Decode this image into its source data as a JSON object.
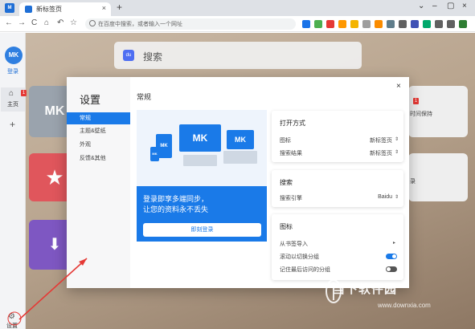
{
  "browser": {
    "app_badge": "M",
    "tab_title": "新标签页",
    "tab_close": "×",
    "new_tab": "+",
    "window_controls": [
      "⌄",
      "–",
      "▢",
      "×"
    ]
  },
  "toolbar": {
    "nav": [
      "←",
      "→",
      "C",
      "⌂",
      "↶",
      "☆"
    ],
    "omnibox_placeholder": "在百度中搜索，或者输入一个网址",
    "extension_colors": [
      "#1a73e8",
      "#4caf50",
      "#e53935",
      "#ff9800",
      "#f4b400",
      "#9e9e9e",
      "#fb8c00",
      "#607d8b",
      "#616161",
      "#3f51b5",
      "#00a86b",
      "#616161",
      "#616161",
      "#2e7d32"
    ]
  },
  "sidebar": {
    "logo": "MK",
    "login": "登录",
    "home_label": "主页",
    "home_badge": "1",
    "add": "+",
    "settings_label": "设置"
  },
  "background": {
    "search_icon": "du",
    "search_text": "搜索",
    "tile_mk": "MK",
    "tile_star": "★",
    "tile_folder": "⬇",
    "right_badge": "1",
    "right_text_1": "时间保持",
    "right_text_2": "录"
  },
  "settings": {
    "heading": "设置",
    "close": "×",
    "nav_items": [
      "常规",
      "主题&壁纸",
      "外观",
      "反馈&其他"
    ],
    "section_title": "常规",
    "promo": {
      "line1": "登录即享多端同步，",
      "line2": "让您的资料永不丢失",
      "button": "即刻登录",
      "logo_text": "MK"
    },
    "open_mode": {
      "title": "打开方式",
      "rows": [
        {
          "label": "图标",
          "value": "新标签页"
        },
        {
          "label": "搜索结果",
          "value": "新标签页"
        }
      ]
    },
    "search": {
      "title": "搜索",
      "rows": [
        {
          "label": "搜索引擎",
          "value": "Baidu"
        }
      ]
    },
    "icons": {
      "title": "图标",
      "import_label": "从书签导入",
      "scroll_label": "滚动以切换分组",
      "remember_label": "记住最后访问的分组",
      "scroll_on": true,
      "remember_on": false
    }
  },
  "watermark": {
    "brand": "当下软件园",
    "url": "www.downxia.com"
  },
  "colors": {
    "accent": "#1a7ae8",
    "badge": "#e53935",
    "toggle_off": "#555555"
  }
}
